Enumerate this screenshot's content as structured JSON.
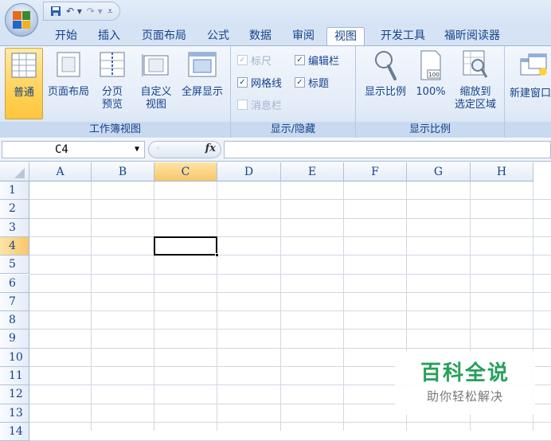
{
  "qat": {
    "save_icon": "save-icon",
    "undo_glyph": "↶ ▾",
    "redo_glyph": "↷ ▾",
    "customize_glyph": "⩡"
  },
  "tabs": [
    {
      "label": "开始"
    },
    {
      "label": "插入"
    },
    {
      "label": "页面布局"
    },
    {
      "label": "公式"
    },
    {
      "label": "数据"
    },
    {
      "label": "审阅"
    },
    {
      "label": "视图"
    },
    {
      "label": "开发工具"
    },
    {
      "label": "福昕阅读器"
    }
  ],
  "active_tab": "视图",
  "ribbon": {
    "workbook_views": {
      "label": "工作簿视图",
      "normal": "普通",
      "page_layout": "页面布局",
      "page_break_1": "分页",
      "page_break_2": "预览",
      "custom_1": "自定义",
      "custom_2": "视图",
      "full_screen": "全屏显示"
    },
    "show_hide": {
      "label": "显示/隐藏",
      "ruler": "标尺",
      "formula_bar": "编辑栏",
      "gridlines": "网格线",
      "headings": "标题",
      "message_bar": "消息栏",
      "ruler_checked": "✓",
      "formula_bar_checked": "✓",
      "gridlines_checked": "✓",
      "headings_checked": "✓"
    },
    "zoom": {
      "label": "显示比例",
      "zoom": "显示比例",
      "hundred": "100%",
      "zoom_sel_1": "缩放到",
      "zoom_sel_2": "选定区域",
      "hundred_icon_text": "100"
    },
    "window": {
      "new_window": "新建窗口"
    }
  },
  "formula_bar": {
    "name_box": "C4",
    "fx": "fx",
    "value": ""
  },
  "columns": [
    "A",
    "B",
    "C",
    "D",
    "E",
    "F",
    "G",
    "H"
  ],
  "rows": [
    "1",
    "2",
    "3",
    "4",
    "5",
    "6",
    "7",
    "8",
    "9",
    "10",
    "11",
    "12",
    "13",
    "14"
  ],
  "selected_cell": "C4",
  "watermark": {
    "title": "百科全说",
    "subtitle": "助你轻松解决"
  },
  "colors": {
    "accent": "#15428b",
    "selection": "#f8c76a",
    "watermark": "#27a05a"
  }
}
